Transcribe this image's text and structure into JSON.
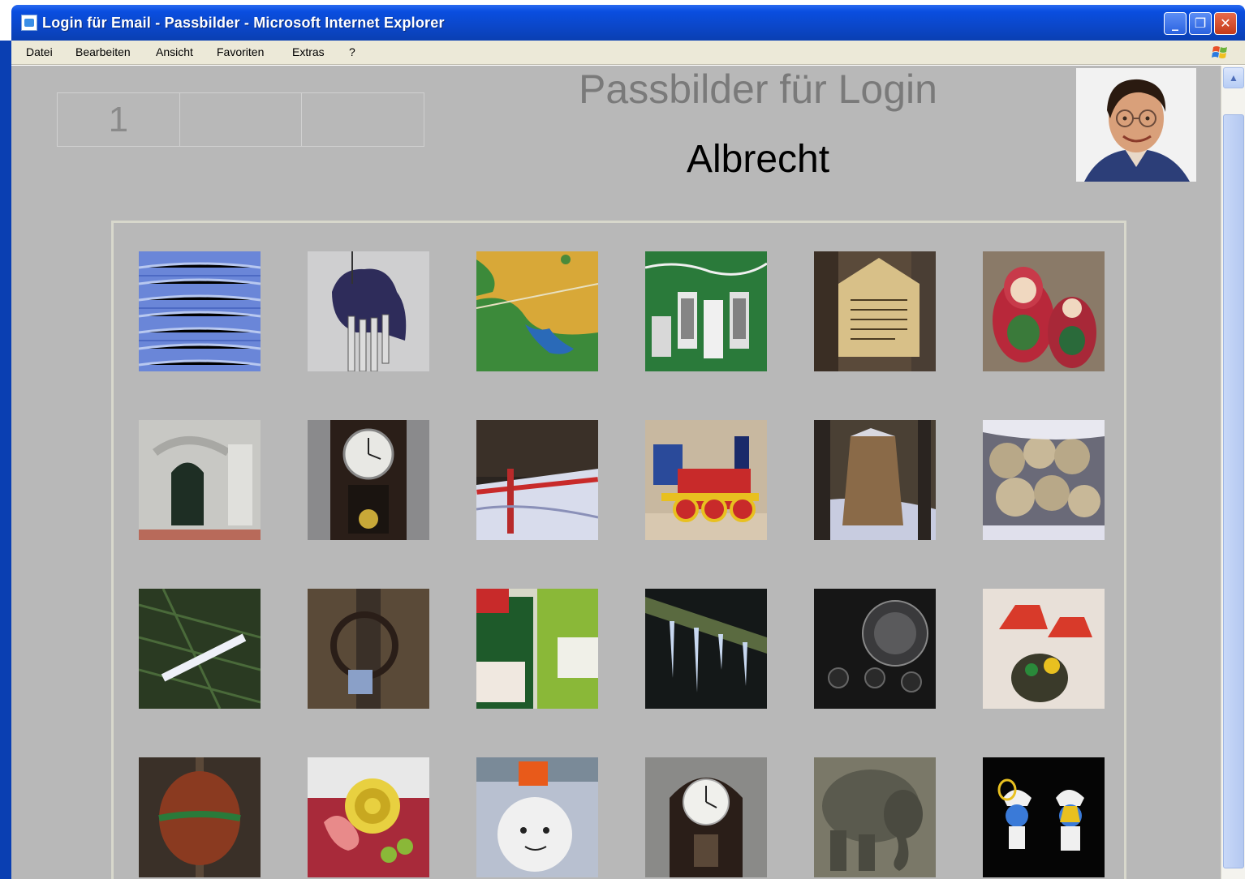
{
  "window": {
    "title": "Login für Email - Passbilder - Microsoft Internet Explorer",
    "minimize_symbol": "_",
    "maximize_symbol": "❐",
    "close_symbol": "✕"
  },
  "menu": {
    "items": [
      "Datei",
      "Bearbeiten",
      "Ansicht",
      "Favoriten",
      "Extras",
      "?"
    ]
  },
  "page": {
    "title": "Passbilder für Login",
    "user_name": "Albrecht",
    "number_cells": [
      "1",
      "",
      ""
    ]
  },
  "thumbnails": [
    {
      "name": "blue-fence-image"
    },
    {
      "name": "bear-windchime-image"
    },
    {
      "name": "map-image"
    },
    {
      "name": "birdhouse-sign-image"
    },
    {
      "name": "wooden-sign-image"
    },
    {
      "name": "matryoshka-dolls-image"
    },
    {
      "name": "window-relief-image"
    },
    {
      "name": "wall-clock-image"
    },
    {
      "name": "snowy-barrier-image"
    },
    {
      "name": "toy-train-image"
    },
    {
      "name": "tree-stump-image"
    },
    {
      "name": "log-pile-image"
    },
    {
      "name": "pine-branch-image"
    },
    {
      "name": "metal-ring-image"
    },
    {
      "name": "bottles-image"
    },
    {
      "name": "icicles-image"
    },
    {
      "name": "radio-knob-image"
    },
    {
      "name": "lamp-figure-image"
    },
    {
      "name": "round-sign-image"
    },
    {
      "name": "snail-toy-image"
    },
    {
      "name": "snowman-image"
    },
    {
      "name": "mantel-clock-image"
    },
    {
      "name": "elephant-image"
    },
    {
      "name": "smurfs-image"
    }
  ],
  "colors": {
    "content_bg": "#b8b8b8",
    "titlebar_blue": "#0a4ee0"
  }
}
